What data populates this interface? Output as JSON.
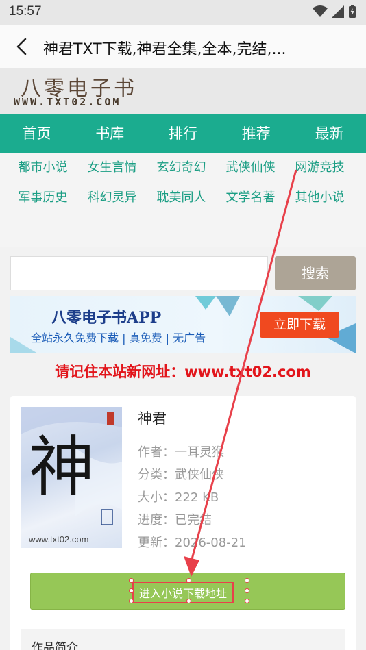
{
  "status_bar": {
    "time": "15:57"
  },
  "title_bar": {
    "title": "神君TXT下载,神君全集,全本,完结,..."
  },
  "site": {
    "logo_cn": "八零电子书",
    "logo_en": "WWW.TXT02.COM"
  },
  "main_nav": [
    "首页",
    "书库",
    "排行",
    "推荐",
    "最新"
  ],
  "categories": [
    "都市小说",
    "女生言情",
    "玄幻奇幻",
    "武侠仙侠",
    "网游竞技",
    "军事历史",
    "科幻灵异",
    "耽美同人",
    "文学名著",
    "其他小说"
  ],
  "search": {
    "placeholder": "",
    "button": "搜索"
  },
  "banner": {
    "title": "八零电子书APP",
    "subtitle": "全站永久免费下载 | 真免费 | 无广告",
    "button": "立即下载"
  },
  "notice": "请记住本站新网址：www.txt02.com",
  "book": {
    "cover_char": "神",
    "cover_url": "www.txt02.com",
    "name": "神君",
    "info": [
      "作者：一耳灵猴",
      "分类：武侠仙侠",
      "大小：222 KB",
      "进度：已完结",
      "更新：2026-08-21"
    ]
  },
  "download": {
    "label": "进入小说下载地址"
  },
  "intro": {
    "title": "作品简介"
  },
  "colors": {
    "nav_green": "#1bac8f",
    "category_green": "#1b9e84",
    "notice_red": "#e2151b",
    "download_green": "#96c757",
    "annotation_red": "#e8404a"
  }
}
